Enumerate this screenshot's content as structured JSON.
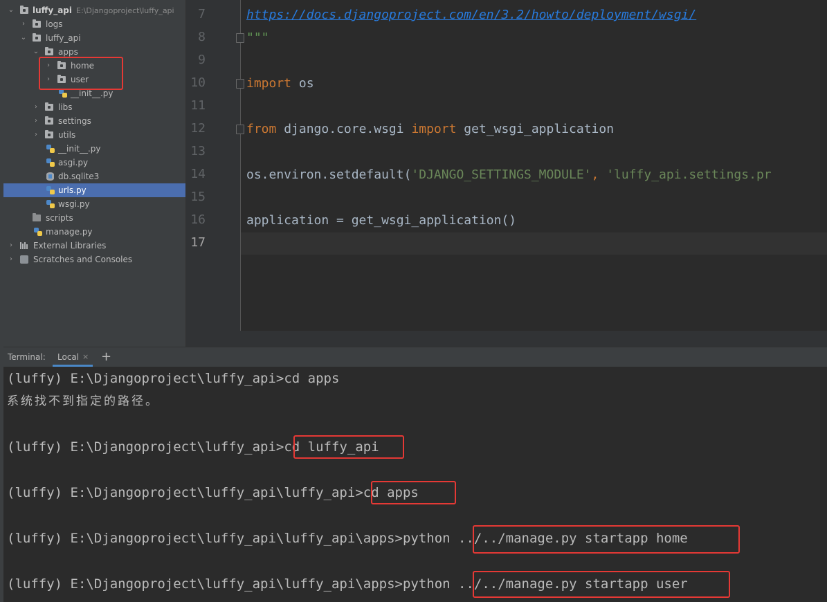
{
  "project_tree": {
    "root": {
      "name": "luffy_api",
      "path": "E:\\Djangoproject\\luffy_api"
    },
    "items": [
      {
        "label": "logs"
      },
      {
        "label": "luffy_api"
      },
      {
        "label": "apps"
      },
      {
        "label": "home"
      },
      {
        "label": "user"
      },
      {
        "label": "__init__.py"
      },
      {
        "label": "libs"
      },
      {
        "label": "settings"
      },
      {
        "label": "utils"
      },
      {
        "label": "__init__.py"
      },
      {
        "label": "asgi.py"
      },
      {
        "label": "db.sqlite3"
      },
      {
        "label": "urls.py"
      },
      {
        "label": "wsgi.py"
      },
      {
        "label": "scripts"
      },
      {
        "label": "manage.py"
      },
      {
        "label": "External Libraries"
      },
      {
        "label": "Scratches and Consoles"
      }
    ],
    "selected": "urls.py"
  },
  "editor": {
    "line_numbers": [
      "7",
      "8",
      "9",
      "10",
      "11",
      "12",
      "13",
      "14",
      "15",
      "16",
      "17"
    ],
    "current_line": "17",
    "lines": {
      "l7": "https://docs.djangoproject.com/en/3.2/howto/deployment/wsgi/",
      "l8": "\"\"\"",
      "l10_kw": "import",
      "l10_rest": " os",
      "l12_kw1": "from",
      "l12_mid": " django.core.wsgi ",
      "l12_kw2": "import",
      "l12_rest": " get_wsgi_application",
      "l14_pre": "os.environ.setdefault(",
      "l14_str1": "'DJANGO_SETTINGS_MODULE'",
      "l14_comma": ", ",
      "l14_str2": "'luffy_api.settings.pr",
      "l16": "application = get_wsgi_application()"
    }
  },
  "terminal": {
    "title": "Terminal:",
    "tab_label": "Local",
    "tab_close": "×",
    "new_tab": "+",
    "lines": [
      "(luffy) E:\\Djangoproject\\luffy_api>cd apps",
      "系统找不到指定的路径。",
      "(luffy) E:\\Djangoproject\\luffy_api>cd luffy_api",
      "(luffy) E:\\Djangoproject\\luffy_api\\luffy_api>cd apps",
      "(luffy) E:\\Djangoproject\\luffy_api\\luffy_api\\apps>python ../../manage.py startapp home",
      "(luffy) E:\\Djangoproject\\luffy_api\\luffy_api\\apps>python ../../manage.py startapp user"
    ]
  },
  "colors": {
    "highlight_box": "#e53935",
    "selection": "#4b6eaf",
    "keyword": "#cc7832",
    "string": "#6a8759",
    "link": "#287bde"
  }
}
